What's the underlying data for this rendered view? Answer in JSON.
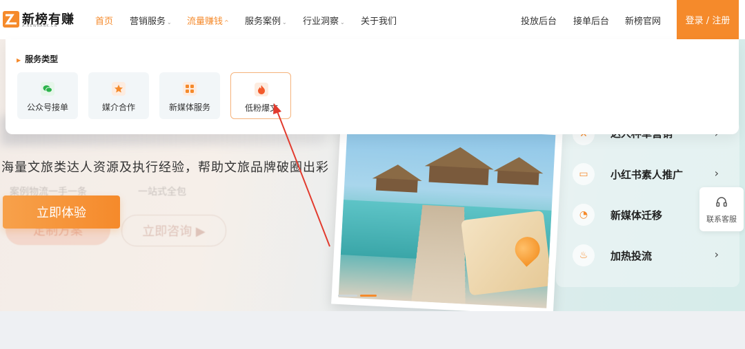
{
  "header": {
    "logo_text": "新榜有赚",
    "logo_sub": "A.NEWRANK.CN",
    "nav": [
      {
        "label": "首页",
        "has_caret": false
      },
      {
        "label": "营销服务",
        "has_caret": true
      },
      {
        "label": "流量赚钱",
        "has_caret": true
      },
      {
        "label": "服务案例",
        "has_caret": true
      },
      {
        "label": "行业洞察",
        "has_caret": true
      },
      {
        "label": "关于我们",
        "has_caret": false
      }
    ],
    "right_links": [
      "投放后台",
      "接单后台",
      "新榜官网"
    ],
    "login_label": "登录 / 注册"
  },
  "dropdown": {
    "section_title": "服务类型",
    "services": [
      {
        "label": "公众号接单",
        "icon": "wechat-icon"
      },
      {
        "label": "媒介合作",
        "icon": "star-icon"
      },
      {
        "label": "新媒体服务",
        "icon": "grid-icon"
      },
      {
        "label": "低粉爆文",
        "icon": "fire-icon"
      }
    ],
    "selected_index": 3
  },
  "hero": {
    "subtitle": "海量文旅类达人资源及执行经验，帮助文旅品牌破圈出彩",
    "primary_cta": "立即体验",
    "ghost_cta_1": "定制方案",
    "ghost_cta_2": "立即咨询 ▶",
    "ghost_line_1": "一站式全包",
    "ghost_line_2": "案例物流一手一条"
  },
  "side_menu": [
    {
      "label": "达人种草营销"
    },
    {
      "label": "小红书素人推广"
    },
    {
      "label": "新媒体迁移"
    },
    {
      "label": "加热投流"
    }
  ],
  "contact": {
    "label": "联系客服"
  },
  "colors": {
    "accent": "#f58a2b",
    "selected_border": "#f5b27a",
    "arrow": "#e23b2e"
  }
}
